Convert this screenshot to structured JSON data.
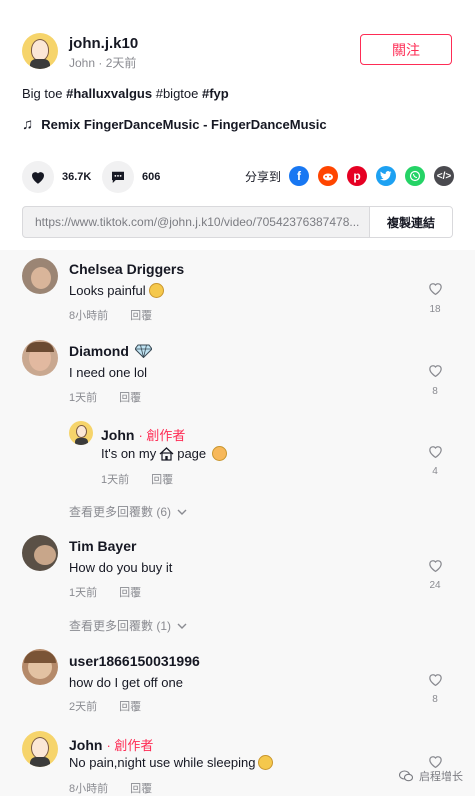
{
  "header": {
    "username": "john.j.k10",
    "author": "John",
    "time_ago": "2天前",
    "follow_label": "關注"
  },
  "caption": {
    "text": "Big toe",
    "tags": [
      "#halluxvalgus",
      "#bigtoe",
      "#fyp"
    ]
  },
  "music": {
    "title": "Remix FingerDanceMusic - FingerDanceMusic"
  },
  "actions": {
    "likes": "36.7K",
    "comments": "606",
    "share_label": "分享到"
  },
  "share_targets": [
    "facebook-icon",
    "reddit-icon",
    "pinterest-icon",
    "twitter-icon",
    "whatsapp-icon",
    "embed-icon"
  ],
  "link": {
    "url": "https://www.tiktok.com/@john.j.k10/video/70542376387478...",
    "copy_label": "複製連結"
  },
  "comments": [
    {
      "name": "Chelsea Driggers",
      "text": "Looks painful",
      "time": "8小時前",
      "reply": "回覆",
      "likes": "18"
    },
    {
      "name": "Diamond",
      "text": "I need one lol",
      "time": "1天前",
      "reply": "回覆",
      "likes": "8",
      "replies": [
        {
          "name": "John",
          "creator": "創作者",
          "text_before": "It's on my",
          "text_after": "page",
          "time": "1天前",
          "reply": "回覆",
          "likes": "4"
        }
      ],
      "more": "查看更多回覆數 (6)"
    },
    {
      "name": "Tim Bayer",
      "text": "How do you buy it",
      "time": "1天前",
      "reply": "回覆",
      "likes": "24",
      "more": "查看更多回覆數 (1)"
    },
    {
      "name": "user1866150031996",
      "text": "how do I get off one",
      "time": "2天前",
      "reply": "回覆",
      "likes": "8"
    },
    {
      "name": "John",
      "creator": "創作者",
      "text": "No pain,night use while sleeping",
      "time": "8小時前",
      "reply": "回覆",
      "likes": ""
    }
  ],
  "watermark": "启程增长",
  "colors": {
    "accent": "#fe2c55",
    "facebook": "#1877f2",
    "reddit": "#ff4500",
    "pinterest": "#e60023",
    "twitter": "#1da1f2",
    "whatsapp": "#25d366",
    "embed": "#4a4a4f"
  }
}
